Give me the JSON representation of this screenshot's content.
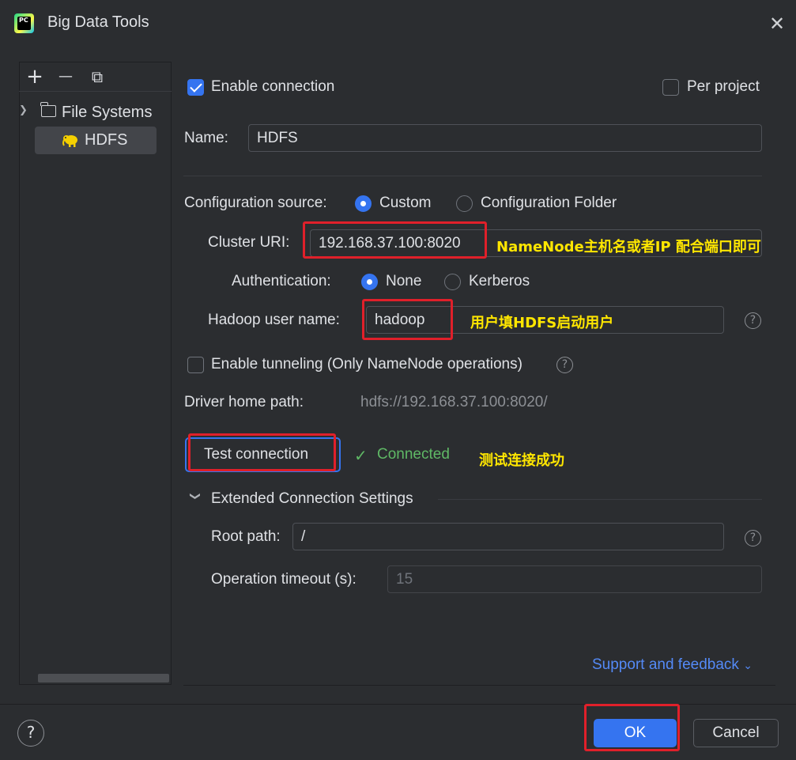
{
  "window": {
    "title": "Big Data Tools",
    "app_logo_text": "PC"
  },
  "sidebar": {
    "toolbar": {
      "add": "+",
      "remove": "—",
      "copy": "⧉"
    },
    "tree": {
      "group_label": "File Systems",
      "items": [
        {
          "label": "HDFS",
          "selected": true
        }
      ]
    }
  },
  "form": {
    "enable_connection": {
      "label": "Enable connection",
      "checked": true
    },
    "per_project": {
      "label": "Per project",
      "checked": false
    },
    "name": {
      "label": "Name:",
      "value": "HDFS"
    },
    "config_source": {
      "label": "Configuration source:",
      "options": [
        {
          "label": "Custom",
          "selected": true
        },
        {
          "label": "Configuration Folder",
          "selected": false
        }
      ]
    },
    "cluster_uri": {
      "label": "Cluster URI:",
      "value": "192.168.37.100:8020"
    },
    "authentication": {
      "label": "Authentication:",
      "options": [
        {
          "label": "None",
          "selected": true
        },
        {
          "label": "Kerberos",
          "selected": false
        }
      ]
    },
    "hadoop_user": {
      "label": "Hadoop user name:",
      "value": "hadoop"
    },
    "tunneling": {
      "label": "Enable tunneling (Only NameNode operations)",
      "checked": false
    },
    "driver_home": {
      "label": "Driver home path:",
      "value": "hdfs://192.168.37.100:8020/"
    },
    "test_button": "Test connection",
    "test_status": "Connected",
    "extended": {
      "title": "Extended Connection Settings",
      "root_path": {
        "label": "Root path:",
        "value": "/"
      },
      "timeout": {
        "label": "Operation timeout (s):",
        "placeholder": "15"
      }
    },
    "support_link": "Support and feedback"
  },
  "annotations": {
    "cluster_uri_note": "NameNode主机名或者IP  配合端口即可",
    "user_note": "用户填HDFS启动用户",
    "test_note": "测试连接成功"
  },
  "footer": {
    "help": "?",
    "ok": "OK",
    "cancel": "Cancel"
  },
  "colors": {
    "accent": "#3574f0",
    "success": "#5fb865",
    "annotation": "#ffe600",
    "highlight_box": "#e0202a"
  }
}
